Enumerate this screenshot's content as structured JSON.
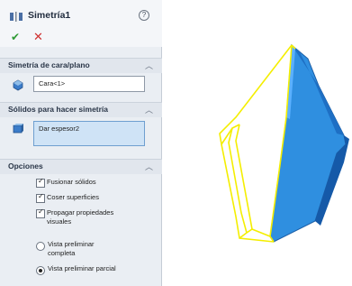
{
  "panel": {
    "title": "Simetría1",
    "help_icon": "?",
    "accept_icon": "check-icon",
    "cancel_icon": "x-icon"
  },
  "sections": {
    "face_plane": {
      "title": "Simetría de cara/plano",
      "value": "Cara<1>"
    },
    "bodies": {
      "title": "Sólidos para hacer simetría",
      "value": "Dar espesor2"
    },
    "options": {
      "title": "Opciones",
      "merge_solids": "Fusionar sólidos",
      "knit_surfaces": "Coser superficies",
      "propagate_line1": "Propagar propiedades",
      "propagate_line2": "visuales",
      "full_preview_line1": "Vista preliminar",
      "full_preview_line2": "completa",
      "partial_preview": "Vista preliminar parcial"
    }
  },
  "colors": {
    "accent_blue": "#2f8fe0",
    "preview_yellow": "#f4ee00",
    "ok_green": "#2f9a35",
    "cancel_red": "#cf3030"
  }
}
